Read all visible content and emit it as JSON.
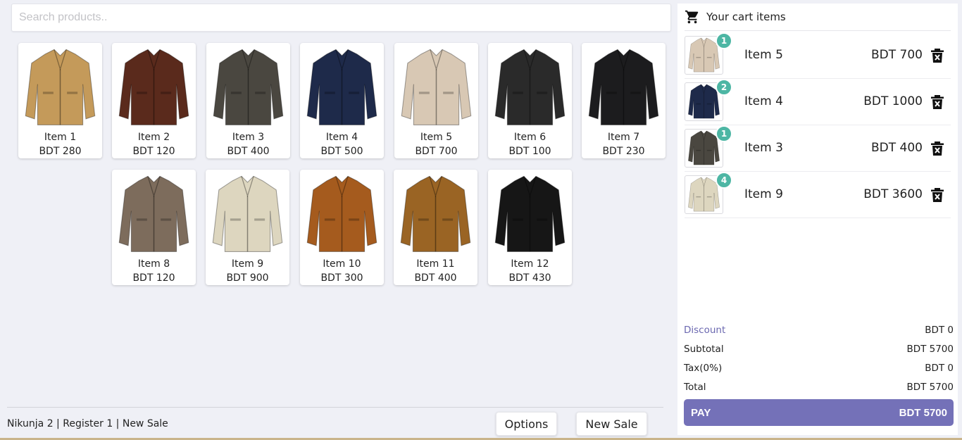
{
  "search": {
    "placeholder": "Search products.."
  },
  "products": [
    {
      "name": "Item 1",
      "price": "BDT 280",
      "color": "#c49a5a"
    },
    {
      "name": "Item 2",
      "price": "BDT 120",
      "color": "#5a2a1c"
    },
    {
      "name": "Item 3",
      "price": "BDT 400",
      "color": "#4a4740"
    },
    {
      "name": "Item 4",
      "price": "BDT 500",
      "color": "#1e2a4a"
    },
    {
      "name": "Item 5",
      "price": "BDT 700",
      "color": "#d8c8b4"
    },
    {
      "name": "Item 6",
      "price": "BDT 100",
      "color": "#2a2a2a"
    },
    {
      "name": "Item 7",
      "price": "BDT 230",
      "color": "#1c1c1e"
    },
    {
      "name": "Item 8",
      "price": "BDT 120",
      "color": "#7d6c5c"
    },
    {
      "name": "Item 9",
      "price": "BDT 900",
      "color": "#ddd6bf"
    },
    {
      "name": "Item 10",
      "price": "BDT 300",
      "color": "#a55b1e"
    },
    {
      "name": "Item 11",
      "price": "BDT 400",
      "color": "#9a6424"
    },
    {
      "name": "Item 12",
      "price": "BDT 430",
      "color": "#161616"
    }
  ],
  "footer": {
    "status": "Nikunja 2 | Register 1 | New Sale",
    "options_label": "Options",
    "new_sale_label": "New Sale"
  },
  "cart": {
    "title": "Your cart items",
    "items": [
      {
        "name": "Item 5",
        "qty": "1",
        "price": "BDT 700",
        "color": "#d8c8b4"
      },
      {
        "name": "Item 4",
        "qty": "2",
        "price": "BDT 1000",
        "color": "#1e2a4a"
      },
      {
        "name": "Item 3",
        "qty": "1",
        "price": "BDT 400",
        "color": "#4a4740"
      },
      {
        "name": "Item 9",
        "qty": "4",
        "price": "BDT 3600",
        "color": "#ddd6bf"
      }
    ],
    "summary": {
      "discount_label": "Discount",
      "discount_value": "BDT 0",
      "subtotal_label": "Subtotal",
      "subtotal_value": "BDT 5700",
      "tax_label": "Tax(0%)",
      "tax_value": "BDT 0",
      "total_label": "Total",
      "total_value": "BDT 5700"
    },
    "pay": {
      "label": "PAY",
      "amount": "BDT 5700"
    }
  },
  "colors": {
    "accent": "#7471b8",
    "qty_badge": "#4db6a4",
    "discount_link": "#6b68b0",
    "background": "#eff0f6"
  },
  "icons": {
    "cart": "shopping-cart-icon",
    "delete": "delete-icon",
    "product": "jacket-icon"
  }
}
